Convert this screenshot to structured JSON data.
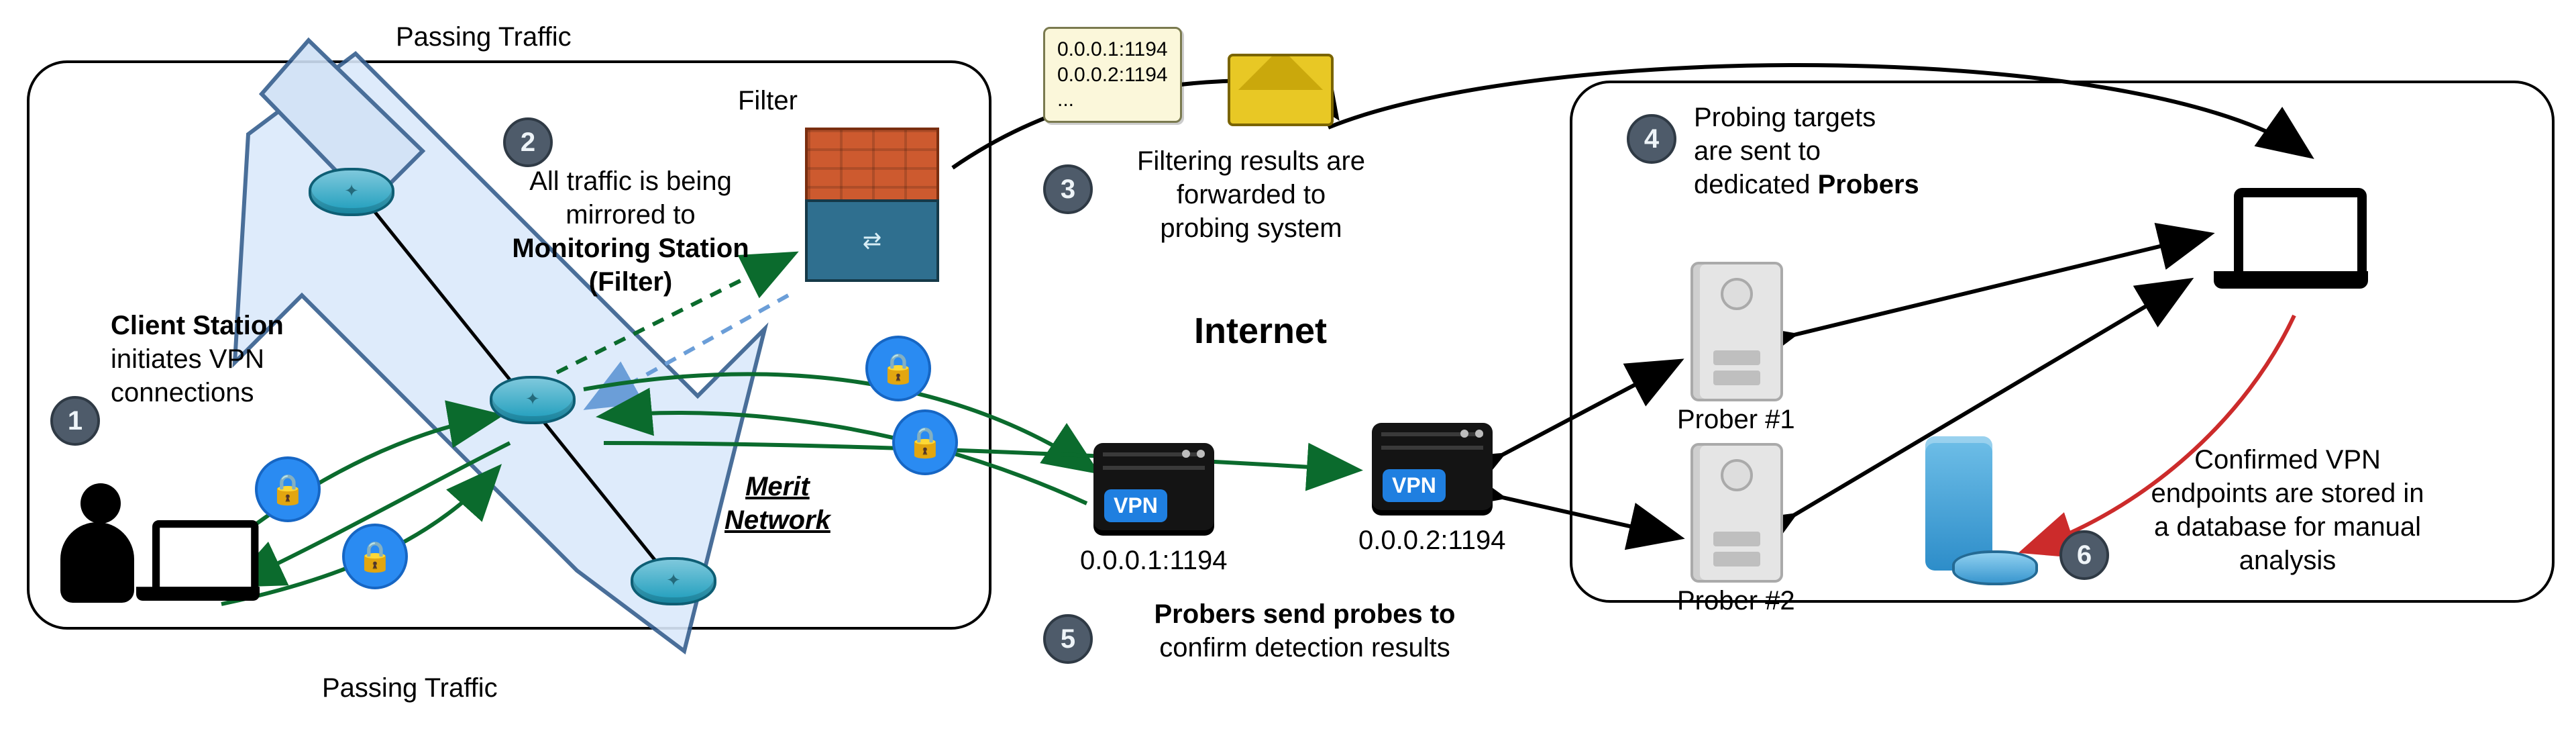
{
  "steps": {
    "1": {
      "num": "1",
      "text_a": "Client Station",
      "text_b": "initiates VPN",
      "text_c": "connections"
    },
    "2": {
      "num": "2",
      "text_a": "All traffic is being",
      "text_b": "mirrored to",
      "text_c": "Monitoring Station",
      "text_d": "(Filter)",
      "filter_label": "Filter"
    },
    "3": {
      "num": "3",
      "text_a": "Filtering results are",
      "text_b": "forwarded to",
      "text_c": "probing system",
      "ip1": "0.0.0.1:1194",
      "ip2": "0.0.0.2:1194",
      "ip3": "..."
    },
    "4": {
      "num": "4",
      "text_a": "Probing targets",
      "text_b": "are sent to",
      "text_c": "dedicated Probers"
    },
    "5": {
      "num": "5",
      "text_a": "Probers send probes to",
      "text_b": "confirm detection results",
      "vpn1_label": "0.0.0.1:1194",
      "vpn2_label": "0.0.0.2:1194",
      "vpn_tag": "VPN"
    },
    "6": {
      "num": "6",
      "text_a": "Confirmed VPN",
      "text_b": "endpoints are stored in",
      "text_c": "a database for manual",
      "text_d": "analysis"
    }
  },
  "labels": {
    "passing_traffic": "Passing Traffic",
    "merit_a": "Merit",
    "merit_b": "Network",
    "internet": "Internet",
    "prober1": "Prober #1",
    "prober2": "Prober #2"
  }
}
